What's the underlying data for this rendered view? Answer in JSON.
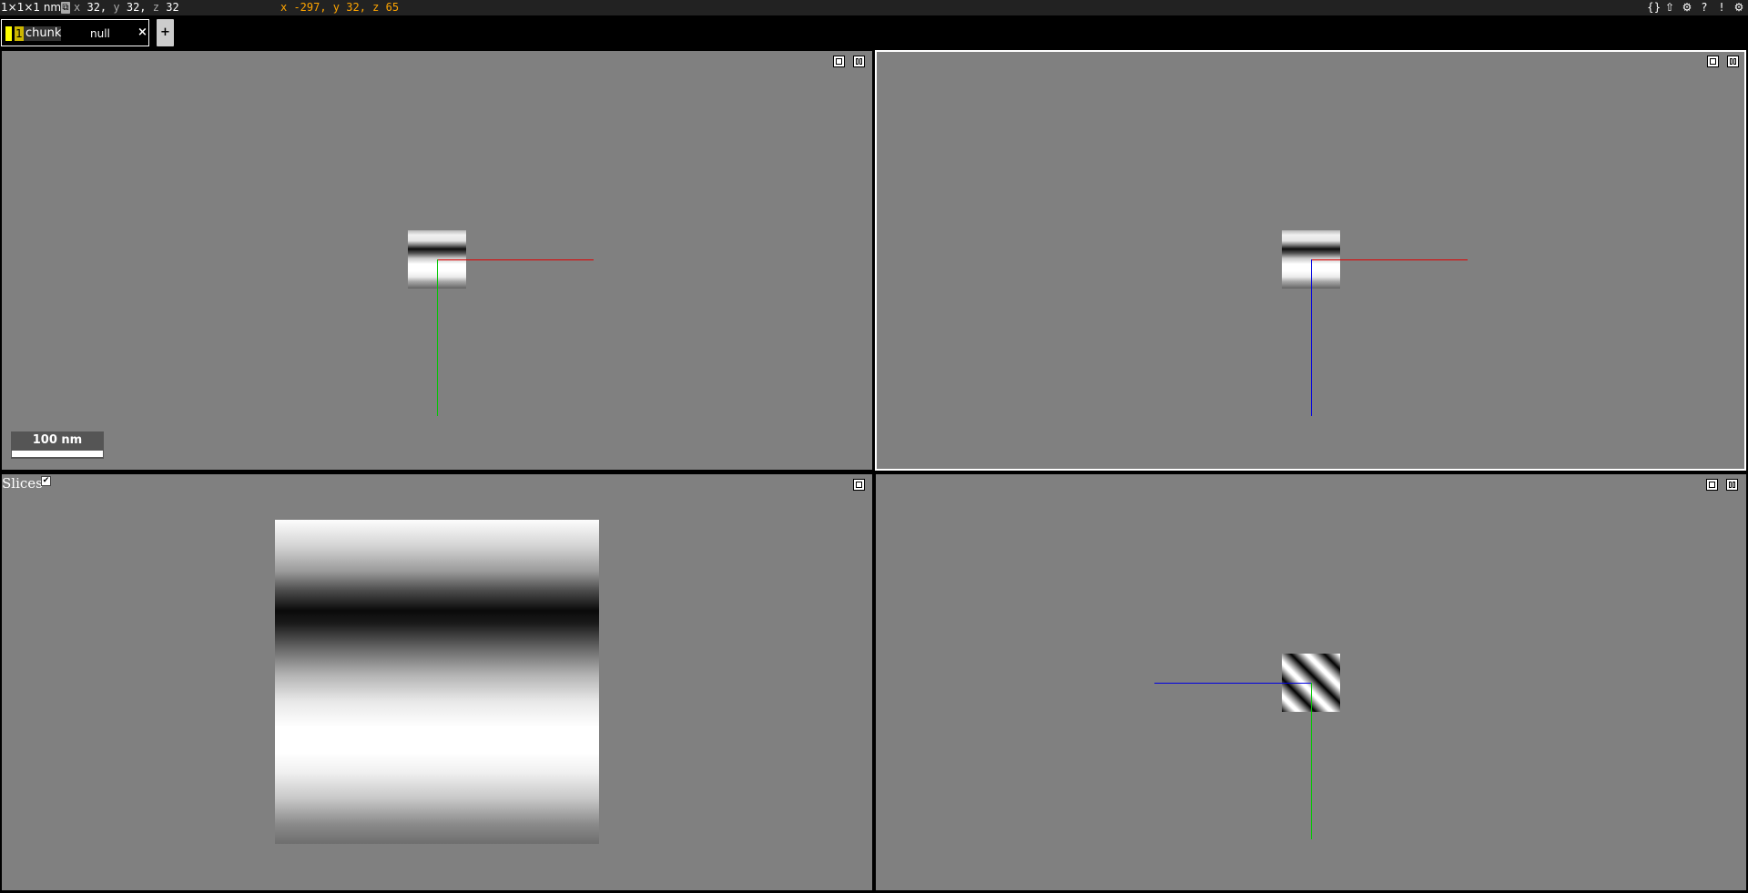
{
  "topbar": {
    "dimensions": "1×1×1 nm³",
    "link_icon": "link-icon",
    "coords": {
      "x_label": "x",
      "x": "32,",
      "y_label": "y",
      "y": "32,",
      "z_label": "z",
      "z": "32"
    },
    "mouse_position": "x -297, y 32, z 65",
    "icons": [
      {
        "name": "json-state-icon",
        "glyph": "{}"
      },
      {
        "name": "upload-icon",
        "glyph": "⇧"
      },
      {
        "name": "settings-icon",
        "glyph": "⚙"
      },
      {
        "name": "help-icon",
        "glyph": "?"
      },
      {
        "name": "alert-icon",
        "glyph": "!"
      },
      {
        "name": "layer-panel-icon",
        "glyph": "⚙"
      }
    ]
  },
  "layer": {
    "number": "1",
    "name": "chunk",
    "value": "null",
    "close": "×"
  },
  "add_layer": "+",
  "scalebar": {
    "label": "100 nm"
  },
  "slices_panel": {
    "label": "Slices",
    "checked": true
  },
  "colors": {
    "accent_orange": "#ffa500",
    "layer_yellow": "#ffff00",
    "panel_gray": "#808080"
  }
}
